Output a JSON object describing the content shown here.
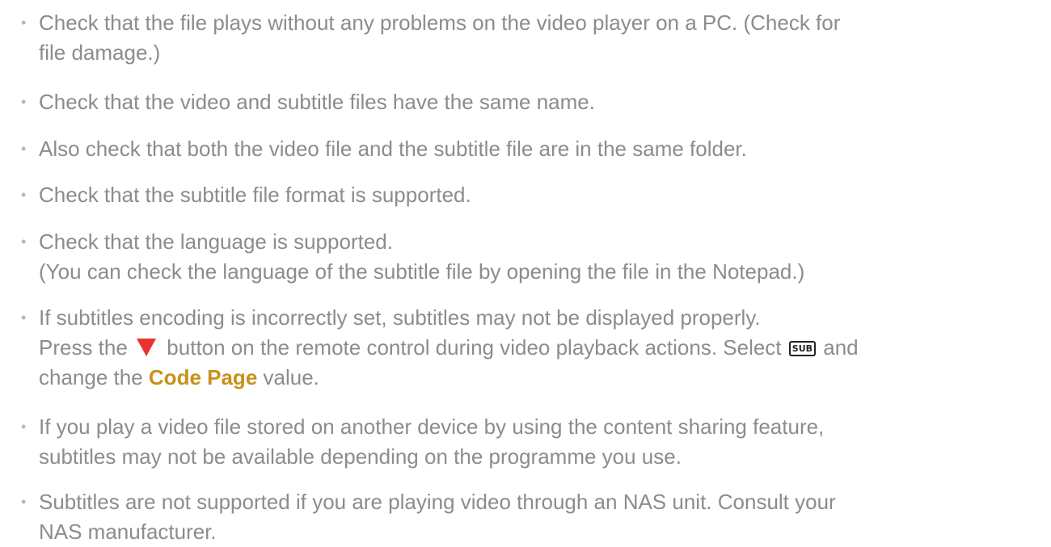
{
  "bullet": "•",
  "tips": [
    {
      "lines": [
        "Check that the file plays without any problems on the video player on a PC. (Check for",
        "file damage.)"
      ]
    },
    {
      "lines": [
        "Check that the video and subtitle files have the same name."
      ]
    },
    {
      "lines": [
        "Also check that both the video file and the subtitle file are in the same folder."
      ]
    },
    {
      "lines": [
        "Check that the subtitle file format is supported."
      ]
    },
    {
      "lines": [
        "Check that the language is supported.",
        "(You can check the language of the subtitle file by opening the file in the Notepad.)"
      ]
    },
    {
      "line1": "If subtitles encoding is incorrectly set, subtitles may not be displayed properly.",
      "line2_before_icon": "Press the",
      "line2_after_icon": "button on the remote control during video playback actions. Select",
      "sub_key_label": "SUB",
      "line2_end": "and",
      "line3_before": "change the",
      "code_page_label": "Code Page",
      "line3_after": "value.",
      "arrow_icon": "down-triangle-icon",
      "arrow_color": "#e8342e",
      "highlight_color": "#c8911a"
    },
    {
      "lines": [
        "If you play a video file stored on another device by using the content sharing feature,",
        "subtitles may not be available depending on the programme you use."
      ]
    },
    {
      "lines": [
        "Subtitles are not supported if you are playing video through an NAS unit. Consult your",
        "NAS manufacturer."
      ]
    }
  ]
}
